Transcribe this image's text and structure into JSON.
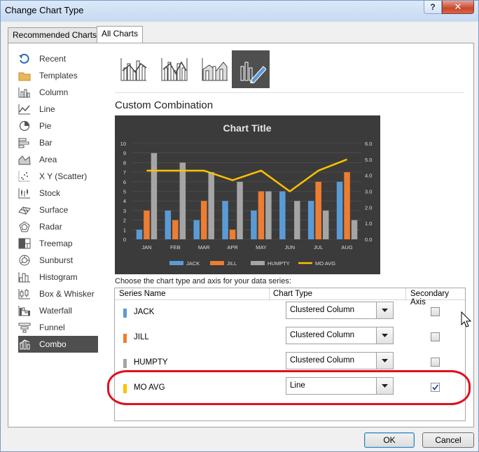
{
  "window": {
    "title": "Change Chart Type",
    "help_label": "?",
    "close_label": "✕"
  },
  "tabs": [
    {
      "label": "Recommended Charts",
      "active": false
    },
    {
      "label": "All Charts",
      "active": true
    }
  ],
  "sidebar": {
    "items": [
      {
        "label": "Recent",
        "icon": "recent-icon"
      },
      {
        "label": "Templates",
        "icon": "folder-icon"
      },
      {
        "label": "Column",
        "icon": "column-chart-icon"
      },
      {
        "label": "Line",
        "icon": "line-chart-icon"
      },
      {
        "label": "Pie",
        "icon": "pie-chart-icon"
      },
      {
        "label": "Bar",
        "icon": "bar-chart-icon"
      },
      {
        "label": "Area",
        "icon": "area-chart-icon"
      },
      {
        "label": "X Y (Scatter)",
        "icon": "scatter-chart-icon"
      },
      {
        "label": "Stock",
        "icon": "stock-chart-icon"
      },
      {
        "label": "Surface",
        "icon": "surface-chart-icon"
      },
      {
        "label": "Radar",
        "icon": "radar-chart-icon"
      },
      {
        "label": "Treemap",
        "icon": "treemap-icon"
      },
      {
        "label": "Sunburst",
        "icon": "sunburst-icon"
      },
      {
        "label": "Histogram",
        "icon": "histogram-icon"
      },
      {
        "label": "Box & Whisker",
        "icon": "box-whisker-icon"
      },
      {
        "label": "Waterfall",
        "icon": "waterfall-icon"
      },
      {
        "label": "Funnel",
        "icon": "funnel-icon"
      },
      {
        "label": "Combo",
        "icon": "combo-chart-icon",
        "selected": true
      }
    ]
  },
  "subtypes": [
    {
      "name": "clustered-column-line-icon",
      "selected": false
    },
    {
      "name": "clustered-column-line-secondary-icon",
      "selected": false
    },
    {
      "name": "stacked-area-column-icon",
      "selected": false
    },
    {
      "name": "custom-combination-icon",
      "selected": true
    }
  ],
  "main": {
    "heading": "Custom Combination",
    "instruction": "Choose the chart type and axis for your data series:",
    "columns": {
      "series_name": "Series Name",
      "chart_type": "Chart Type",
      "secondary_axis": "Secondary Axis"
    },
    "series": [
      {
        "name": "JACK",
        "color": "#5b9bd5",
        "chart_type": "Clustered Column",
        "secondary": false
      },
      {
        "name": "JILL",
        "color": "#ed7d31",
        "chart_type": "Clustered Column",
        "secondary": false
      },
      {
        "name": "HUMPTY",
        "color": "#a5a5a5",
        "chart_type": "Clustered Column",
        "secondary": false
      },
      {
        "name": "MO AVG",
        "color": "#ffc000",
        "chart_type": "Line",
        "secondary": true
      }
    ]
  },
  "footer": {
    "ok_label": "OK",
    "cancel_label": "Cancel"
  },
  "chart_data": {
    "type": "bar",
    "title": "Chart Title",
    "categories": [
      "JAN",
      "FEB",
      "MAR",
      "APR",
      "MAY",
      "JUN",
      "JUL",
      "AUG"
    ],
    "series": [
      {
        "name": "JACK",
        "type": "bar",
        "axis": "primary",
        "color": "#5b9bd5",
        "values": [
          1,
          3,
          2,
          4,
          3,
          5,
          4,
          6
        ]
      },
      {
        "name": "JILL",
        "type": "bar",
        "axis": "primary",
        "color": "#ed7d31",
        "values": [
          3,
          2,
          4,
          1,
          5,
          0,
          6,
          7
        ]
      },
      {
        "name": "HUMPTY",
        "type": "bar",
        "axis": "primary",
        "color": "#a5a5a5",
        "values": [
          9,
          8,
          7,
          6,
          5,
          4,
          3,
          2
        ]
      },
      {
        "name": "MO AVG",
        "type": "line",
        "axis": "secondary",
        "color": "#ffc000",
        "values": [
          4.3,
          4.3,
          4.3,
          3.7,
          4.3,
          3.0,
          4.3,
          5.0
        ]
      }
    ],
    "y_ticks": [
      "0",
      "1",
      "2",
      "3",
      "4",
      "5",
      "6",
      "7",
      "8",
      "9",
      "10"
    ],
    "y2_ticks": [
      "0.0",
      "1.0",
      "2.0",
      "3.0",
      "4.0",
      "5.0",
      "6.0"
    ],
    "ylim": [
      0,
      10
    ],
    "y2lim": [
      0,
      6
    ],
    "legend": "bottom",
    "grid": true
  }
}
